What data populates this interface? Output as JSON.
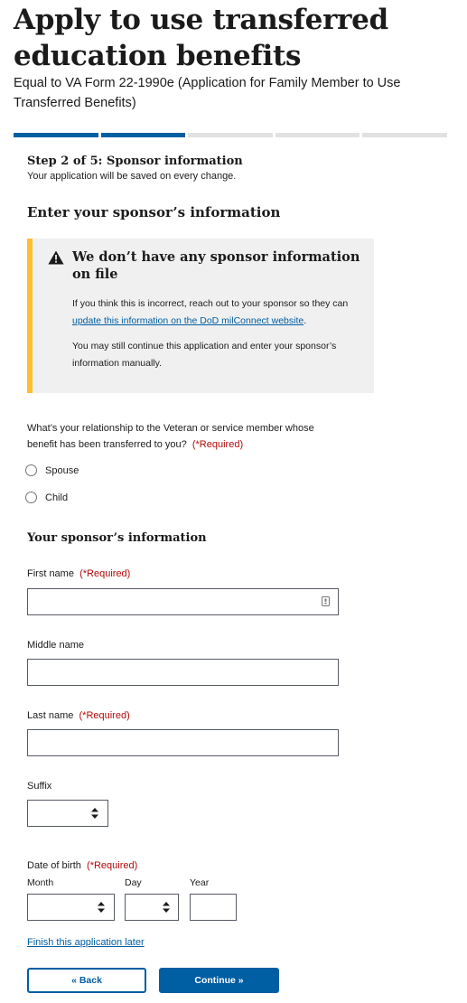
{
  "header": {
    "title": "Apply to use transferred education benefits",
    "subtitle": "Equal to VA Form 22-1990e (Application for Family Member to Use Transferred Benefits)"
  },
  "progress": {
    "total_steps": 5,
    "current_step": 2
  },
  "step": {
    "heading": "Step 2 of 5: Sponsor information",
    "save_note": "Your application will be saved on every change."
  },
  "section_title": "Enter your sponsor’s information",
  "alert": {
    "icon": "warning-icon",
    "heading": "We don’t have any sponsor information on file",
    "p1_before": "If you think this is incorrect, reach out to your sponsor so they can ",
    "p1_link": "update this information on the DoD milConnect website",
    "p1_after": ".",
    "p2": "You may still continue this application and enter your sponsor’s information manually.",
    "border_color": "#ffbe2e"
  },
  "relationship": {
    "question": "What’s your relationship to the Veteran or service member whose benefit has been transferred to you?",
    "required": "(*Required)",
    "options": [
      "Spouse",
      "Child"
    ]
  },
  "sponsor_info": {
    "title": "Your sponsor’s information",
    "first_name": {
      "label": "First name",
      "required": "(*Required)",
      "value": ""
    },
    "middle_name": {
      "label": "Middle name",
      "value": ""
    },
    "last_name": {
      "label": "Last name",
      "required": "(*Required)",
      "value": ""
    },
    "suffix": {
      "label": "Suffix",
      "value": ""
    },
    "dob": {
      "label": "Date of birth",
      "required": "(*Required)",
      "month_label": "Month",
      "day_label": "Day",
      "year_label": "Year",
      "year_value": ""
    }
  },
  "footer": {
    "finish_later": "Finish this application later",
    "back_label": "« Back",
    "continue_label": "Continue »"
  },
  "colors": {
    "primary": "#005ea2",
    "required": "#b50909",
    "warning": "#ffbe2e"
  }
}
